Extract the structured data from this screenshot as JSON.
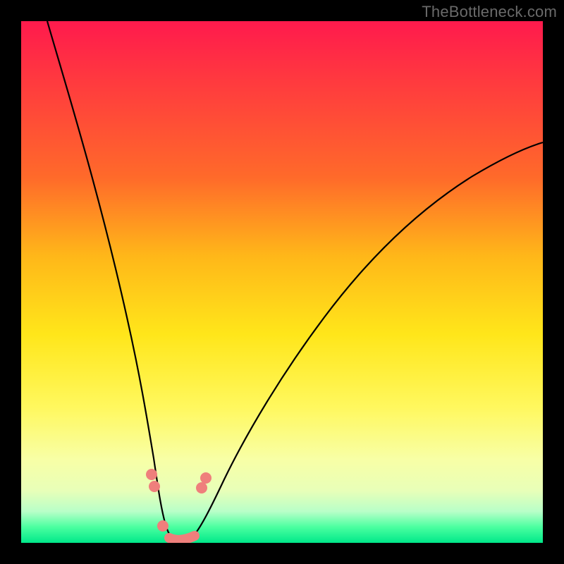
{
  "watermark": "TheBottleneck.com",
  "chart_data": {
    "type": "line",
    "title": "",
    "xlabel": "",
    "ylabel": "",
    "xlim": [
      0,
      100
    ],
    "ylim": [
      0,
      100
    ],
    "background_gradient": {
      "top": "#ff1a4d",
      "mid": "#ffe61a",
      "bottom": "#00e88a",
      "description": "vertical rainbow gradient from red (high bottleneck) to green (low bottleneck)"
    },
    "series": [
      {
        "name": "bottleneck-curve",
        "color": "#000000",
        "x": [
          5,
          10,
          15,
          20,
          22,
          24,
          26,
          27,
          28,
          29,
          30,
          31,
          32,
          34,
          36,
          38,
          42,
          48,
          55,
          62,
          70,
          78,
          86,
          94,
          100
        ],
        "y": [
          100,
          80,
          58,
          36,
          26,
          17,
          10,
          6,
          3,
          1,
          0,
          0,
          0,
          1,
          3,
          7,
          14,
          24,
          34,
          42,
          50,
          57,
          63,
          68,
          71
        ]
      }
    ],
    "markers": [
      {
        "name": "left-upper-dot",
        "x": 25.0,
        "y": 13,
        "r": 8,
        "color": "#ef7f7c"
      },
      {
        "name": "left-upper-dot2",
        "x": 25.6,
        "y": 10,
        "r": 8,
        "color": "#ef7f7c"
      },
      {
        "name": "left-lower-dot",
        "x": 27.3,
        "y": 3,
        "r": 8,
        "color": "#ef7f7c"
      },
      {
        "name": "right-upper-dot",
        "x": 34.3,
        "y": 10,
        "r": 8,
        "color": "#ef7f7c"
      },
      {
        "name": "right-upper-dot2",
        "x": 35.0,
        "y": 12,
        "r": 8,
        "color": "#ef7f7c"
      },
      {
        "name": "bottom-segment-start",
        "x": 28.5,
        "y": 1,
        "r": 7,
        "color": "#ef7f7c"
      },
      {
        "name": "bottom-segment-end",
        "x": 33.0,
        "y": 1,
        "r": 7,
        "color": "#ef7f7c"
      }
    ],
    "notes": "V-shaped bottleneck curve with minimum near x≈30; salmon markers cluster near the trough."
  }
}
